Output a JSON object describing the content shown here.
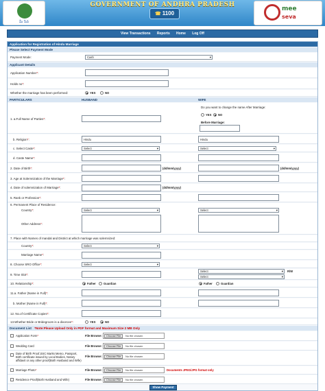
{
  "header": {
    "title": "GOVERNMENT OF ANDHRA PRADESH",
    "helpline": "1100",
    "logo_left_text": "మీ సేవ",
    "logo_right_line1": "mee",
    "logo_right_line2": "seva"
  },
  "nav": [
    "View Transactions",
    "Reports",
    "Home",
    "Log Off"
  ],
  "form": {
    "title": "Application for Registration of Hindu Marriage",
    "payment_section": "Please Select Payment Mode",
    "payment_label": "Payment Mode:",
    "payment_value": "Cash",
    "applicant_section": "Applicant Details",
    "app_number_label": "Application Number",
    "holds_label": "Holds no",
    "whether_label": "Whether the marriage has been performed:",
    "yes": "YES",
    "no": "NO",
    "particulars": "PARTICULARS",
    "husband": "HUSBAND",
    "wife": "WIFE",
    "change_name_q": "Do you want to change the name After Marriage:",
    "before_marriage": "Before Marriage:",
    "full_name_label": "1. a.Full Name of Parties",
    "religion_label": "b. Religion",
    "religion_h": "Hindu",
    "religion_w": "Hindu",
    "caste_label": "c. Select Caste",
    "select": "Select",
    "caste_name_label": "d. Caste Name",
    "dob_label": "2. Date of Birth",
    "date_fmt": "(dd/mm/yyyy)",
    "age_label": "3. Age at Solemnization of the Marriage",
    "date_sol_label": "4. Date of solemnization of Marriage",
    "rank_label": "5. Rank or Profession",
    "perm_label": "6. Permanent Place of Residence:",
    "country_label": "Country",
    "other_addr_label": "Other Address",
    "place_label": "7. Place with Names of mandal and District at which  marriage was solemnized:",
    "country2_label": "Country",
    "marriage_name_label": "Marriage Name",
    "state_label": "8. Choose SRO Office",
    "time_label": "9. Time Slot",
    "time_rw": "R/W",
    "relationship_label": "10. Relationship",
    "father": "Father",
    "guardian": "Guardian",
    "father_name_label": "11.a. Father (Name in Full)",
    "mother_name_label": "b. Mother (Name in Full)",
    "copies_label": "12. No.of Certificate Copies",
    "divorcee_label": "13.Whether Bride or Bridegroom is a divorcee",
    "doc_list": "Document List",
    "doc_note": "*Note:Please Upload Only in PDF format and Maximum Size 2 MB Only",
    "file_browse": "File Browse:",
    "choose_file": "Choose File",
    "no_file": "No file chosen",
    "docs": [
      "Application Form",
      "Wedding Card",
      "Date of Birth Proof,SSC Marks Memo, Passport, Birth certificate issued by Local Bodies, Notary affidavit or any other proof(Both Husband and Wife)",
      "Marriage Photo",
      "Residence Proof(Both Husband and Wife)"
    ],
    "photo_note": "Documents JPEG/JPG format only",
    "submit": "Show Payment"
  }
}
